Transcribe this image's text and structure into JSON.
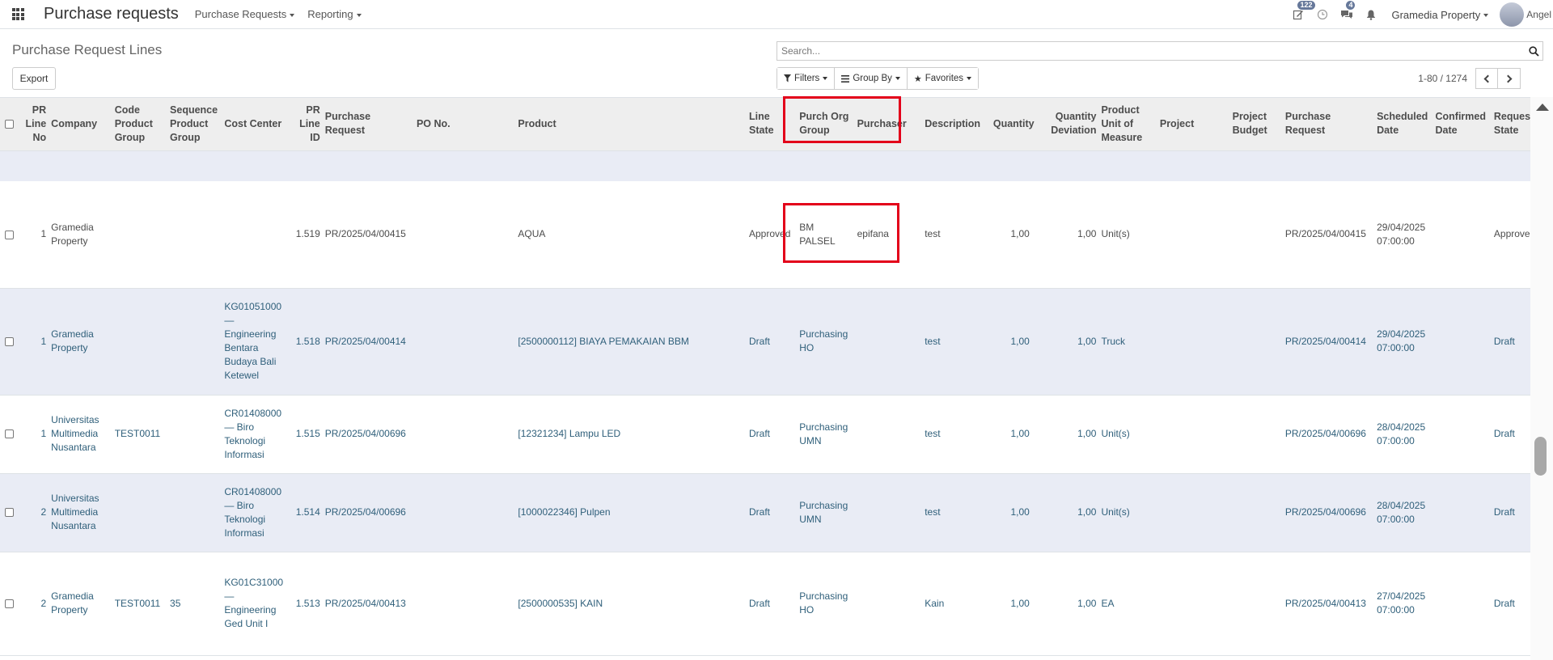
{
  "navbar": {
    "app_title": "Purchase requests",
    "menus": [
      "Purchase Requests",
      "Reporting"
    ],
    "activity_badge": "122",
    "messages_badge": "4",
    "company": "Gramedia Property",
    "user": "Angel"
  },
  "control_panel": {
    "breadcrumb": "Purchase Request Lines",
    "search_placeholder": "Search...",
    "export_label": "Export",
    "filters_label": "Filters",
    "groupby_label": "Group By",
    "favorites_label": "Favorites",
    "pager_value": "1-80 / 1274"
  },
  "table": {
    "columns": [
      "PR Line No",
      "Company",
      "Code Product Group",
      "Sequence Product Group",
      "Cost Center",
      "PR Line ID",
      "Purchase Request",
      "PO No.",
      "Product",
      "Line State",
      "Purch Org Group",
      "Purchaser",
      "Description",
      "Quantity",
      "Quantity Deviation",
      "Product Unit of Measure",
      "Project",
      "Project Budget",
      "Purchase Request",
      "Scheduled Date",
      "Confirmed Date",
      "Request State"
    ],
    "rows": [
      {
        "line_no": "1",
        "company": "Gramedia Property",
        "code_pg": "",
        "seq_pg": "",
        "cost_center": "",
        "line_id": "1.519",
        "purchase_request": "PR/2025/04/00415",
        "po_no": "",
        "product": "AQUA",
        "line_state": "Approved",
        "purch_org": "BM PALSEL",
        "purchaser": "epifana",
        "description": "test",
        "quantity": "1,00",
        "qty_deviation": "1,00",
        "uom": "Unit(s)",
        "project": "",
        "project_budget": "",
        "purchase_request2": "PR/2025/04/00415",
        "scheduled": "29/04/2025 07:00:00",
        "confirmed": "",
        "request_state": "Approved"
      },
      {
        "line_no": "1",
        "company": "Gramedia Property",
        "code_pg": "",
        "seq_pg": "",
        "cost_center": "KG01051000 — Engineering Bentara Budaya Bali Ketewel",
        "line_id": "1.518",
        "purchase_request": "PR/2025/04/00414",
        "po_no": "",
        "product": "[2500000112] BIAYA PEMAKAIAN BBM",
        "line_state": "Draft",
        "purch_org": "Purchasing HO",
        "purchaser": "",
        "description": "test",
        "quantity": "1,00",
        "qty_deviation": "1,00",
        "uom": "Truck",
        "project": "",
        "project_budget": "",
        "purchase_request2": "PR/2025/04/00414",
        "scheduled": "29/04/2025 07:00:00",
        "confirmed": "",
        "request_state": "Draft"
      },
      {
        "line_no": "1",
        "company": "Universitas Multimedia Nusantara",
        "code_pg": "TEST0011",
        "seq_pg": "",
        "cost_center": "CR01408000 — Biro Teknologi Informasi",
        "line_id": "1.515",
        "purchase_request": "PR/2025/04/00696",
        "po_no": "",
        "product": "[12321234] Lampu LED",
        "line_state": "Draft",
        "purch_org": "Purchasing UMN",
        "purchaser": "",
        "description": "test",
        "quantity": "1,00",
        "qty_deviation": "1,00",
        "uom": "Unit(s)",
        "project": "",
        "project_budget": "",
        "purchase_request2": "PR/2025/04/00696",
        "scheduled": "28/04/2025 07:00:00",
        "confirmed": "",
        "request_state": "Draft"
      },
      {
        "line_no": "2",
        "company": "Universitas Multimedia Nusantara",
        "code_pg": "",
        "seq_pg": "",
        "cost_center": "CR01408000 — Biro Teknologi Informasi",
        "line_id": "1.514",
        "purchase_request": "PR/2025/04/00696",
        "po_no": "",
        "product": "[1000022346] Pulpen",
        "line_state": "Draft",
        "purch_org": "Purchasing UMN",
        "purchaser": "",
        "description": "test",
        "quantity": "1,00",
        "qty_deviation": "1,00",
        "uom": "Unit(s)",
        "project": "",
        "project_budget": "",
        "purchase_request2": "PR/2025/04/00696",
        "scheduled": "28/04/2025 07:00:00",
        "confirmed": "",
        "request_state": "Draft"
      },
      {
        "line_no": "2",
        "company": "Gramedia Property",
        "code_pg": "TEST0011",
        "seq_pg": "35",
        "cost_center": "KG01C31000 — Engineering Ged Unit I",
        "line_id": "1.513",
        "purchase_request": "PR/2025/04/00413",
        "po_no": "",
        "product": "[2500000535] KAIN",
        "line_state": "Draft",
        "purch_org": "Purchasing HO",
        "purchaser": "",
        "description": "Kain",
        "quantity": "1,00",
        "qty_deviation": "1,00",
        "uom": "EA",
        "project": "",
        "project_budget": "",
        "purchase_request2": "PR/2025/04/00413",
        "scheduled": "27/04/2025 07:00:00",
        "confirmed": "",
        "request_state": "Draft"
      }
    ]
  },
  "colors": {
    "highlight": "#e3001a",
    "link": "#2f5f7a",
    "row_alt": "#e9ecf5",
    "header_bg": "#eeeeee"
  }
}
